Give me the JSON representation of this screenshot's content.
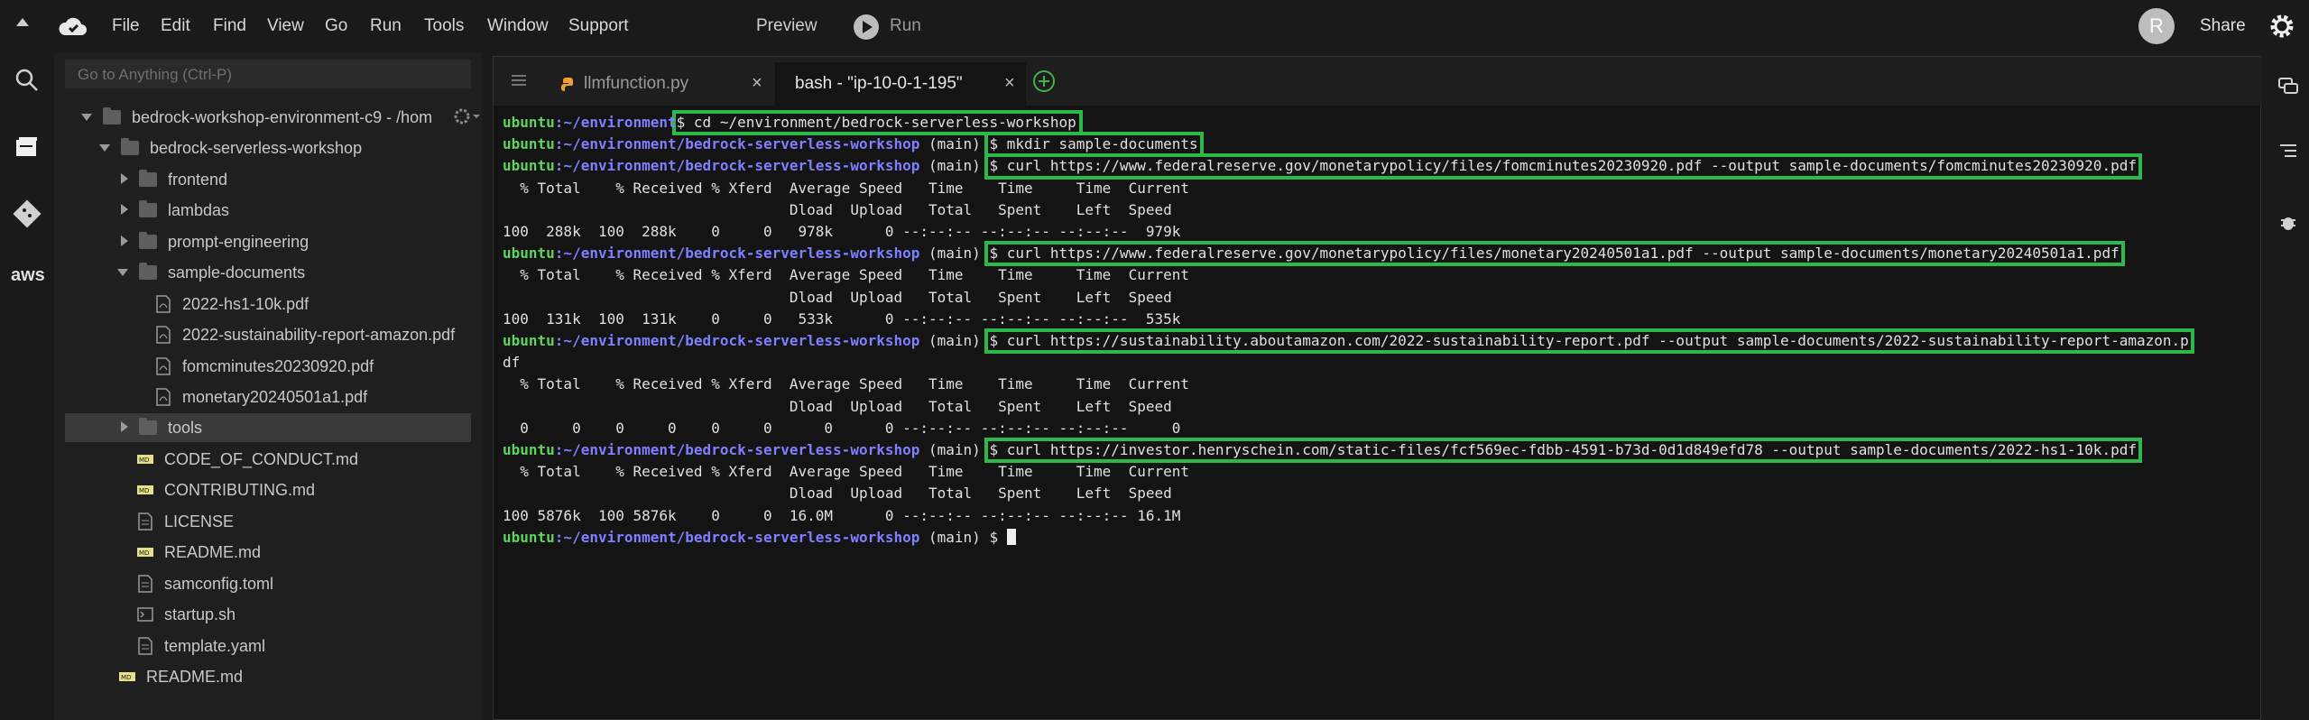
{
  "menubar": {
    "items": [
      "File",
      "Edit",
      "Find",
      "View",
      "Go",
      "Run",
      "Tools",
      "Window",
      "Support"
    ],
    "preview": "Preview",
    "run": "Run",
    "avatar_initial": "R",
    "share": "Share"
  },
  "rail": {
    "aws": "aws"
  },
  "sidebar": {
    "goto_placeholder": "Go to Anything (Ctrl-P)",
    "tree": [
      {
        "label": "bedrock-workshop-environment-c9 - /hom",
        "type": "folder",
        "expanded": true
      },
      {
        "label": "bedrock-serverless-workshop",
        "type": "folder",
        "expanded": true
      },
      {
        "label": "frontend",
        "type": "folder",
        "expanded": false
      },
      {
        "label": "lambdas",
        "type": "folder",
        "expanded": false
      },
      {
        "label": "prompt-engineering",
        "type": "folder",
        "expanded": false
      },
      {
        "label": "sample-documents",
        "type": "folder",
        "expanded": true
      },
      {
        "label": "2022-hs1-10k.pdf",
        "type": "pdf"
      },
      {
        "label": "2022-sustainability-report-amazon.pdf",
        "type": "pdf"
      },
      {
        "label": "fomcminutes20230920.pdf",
        "type": "pdf"
      },
      {
        "label": "monetary20240501a1.pdf",
        "type": "pdf"
      },
      {
        "label": "tools",
        "type": "folder",
        "expanded": false
      },
      {
        "label": "CODE_OF_CONDUCT.md",
        "type": "md"
      },
      {
        "label": "CONTRIBUTING.md",
        "type": "md"
      },
      {
        "label": "LICENSE",
        "type": "text"
      },
      {
        "label": "README.md",
        "type": "md"
      },
      {
        "label": "samconfig.toml",
        "type": "text"
      },
      {
        "label": "startup.sh",
        "type": "shell"
      },
      {
        "label": "template.yaml",
        "type": "text"
      },
      {
        "label": "README.md",
        "type": "md"
      }
    ]
  },
  "tabs": [
    {
      "label": "llmfunction.py",
      "close": "×"
    },
    {
      "label": "bash - \"ip-10-0-1-195\"",
      "close": "×"
    }
  ],
  "terminal": {
    "user": "ubuntu",
    "lines": [
      {
        "kind": "prompt",
        "path": ":~/environment",
        "branch": "",
        "cmd": "$ cd ~/environment/bedrock-serverless-workshop"
      },
      {
        "kind": "prompt",
        "path": ":~/environment/bedrock-serverless-workshop",
        "branch": " (main) ",
        "cmd": "$ mkdir sample-documents"
      },
      {
        "kind": "prompt",
        "path": ":~/environment/bedrock-serverless-workshop",
        "branch": " (main) ",
        "cmd": "$ curl https://www.federalreserve.gov/monetarypolicy/files/fomcminutes20230920.pdf --output sample-documents/fomcminutes20230920.pdf"
      },
      {
        "kind": "out",
        "text": "  % Total    % Received % Xferd  Average Speed   Time    Time     Time  Current"
      },
      {
        "kind": "out",
        "text": "                                 Dload  Upload   Total   Spent    Left  Speed"
      },
      {
        "kind": "out",
        "text": "100  288k  100  288k    0     0   978k      0 --:--:-- --:--:-- --:--:--  979k"
      },
      {
        "kind": "prompt",
        "path": ":~/environment/bedrock-serverless-workshop",
        "branch": " (main) ",
        "cmd": "$ curl https://www.federalreserve.gov/monetarypolicy/files/monetary20240501a1.pdf --output sample-documents/monetary20240501a1.pdf"
      },
      {
        "kind": "out",
        "text": "  % Total    % Received % Xferd  Average Speed   Time    Time     Time  Current"
      },
      {
        "kind": "out",
        "text": "                                 Dload  Upload   Total   Spent    Left  Speed"
      },
      {
        "kind": "out",
        "text": "100  131k  100  131k    0     0   533k      0 --:--:-- --:--:-- --:--:--  535k"
      },
      {
        "kind": "prompt",
        "path": ":~/environment/bedrock-serverless-workshop",
        "branch": " (main) ",
        "cmd": "$ curl https://sustainability.aboutamazon.com/2022-sustainability-report.pdf --output sample-documents/2022-sustainability-report-amazon.p"
      },
      {
        "kind": "out",
        "text": "df"
      },
      {
        "kind": "out",
        "text": "  % Total    % Received % Xferd  Average Speed   Time    Time     Time  Current"
      },
      {
        "kind": "out",
        "text": "                                 Dload  Upload   Total   Spent    Left  Speed"
      },
      {
        "kind": "out",
        "text": "  0     0    0     0    0     0      0      0 --:--:-- --:--:-- --:--:--     0"
      },
      {
        "kind": "prompt",
        "path": ":~/environment/bedrock-serverless-workshop",
        "branch": " (main) ",
        "cmd": "$ curl https://investor.henryschein.com/static-files/fcf569ec-fdbb-4591-b73d-0d1d849efd78 --output sample-documents/2022-hs1-10k.pdf"
      },
      {
        "kind": "out",
        "text": "  % Total    % Received % Xferd  Average Speed   Time    Time     Time  Current"
      },
      {
        "kind": "out",
        "text": "                                 Dload  Upload   Total   Spent    Left  Speed"
      },
      {
        "kind": "out",
        "text": "100 5876k  100 5876k    0     0  16.0M      0 --:--:-- --:--:-- --:--:-- 16.1M"
      },
      {
        "kind": "prompt",
        "path": ":~/environment/bedrock-serverless-workshop",
        "branch": " (main) ",
        "cmd": "$ "
      }
    ]
  },
  "colors": {
    "highlight": "#2fb84a",
    "prompt_user": "#5fd35f",
    "prompt_path": "#7f7fff"
  }
}
